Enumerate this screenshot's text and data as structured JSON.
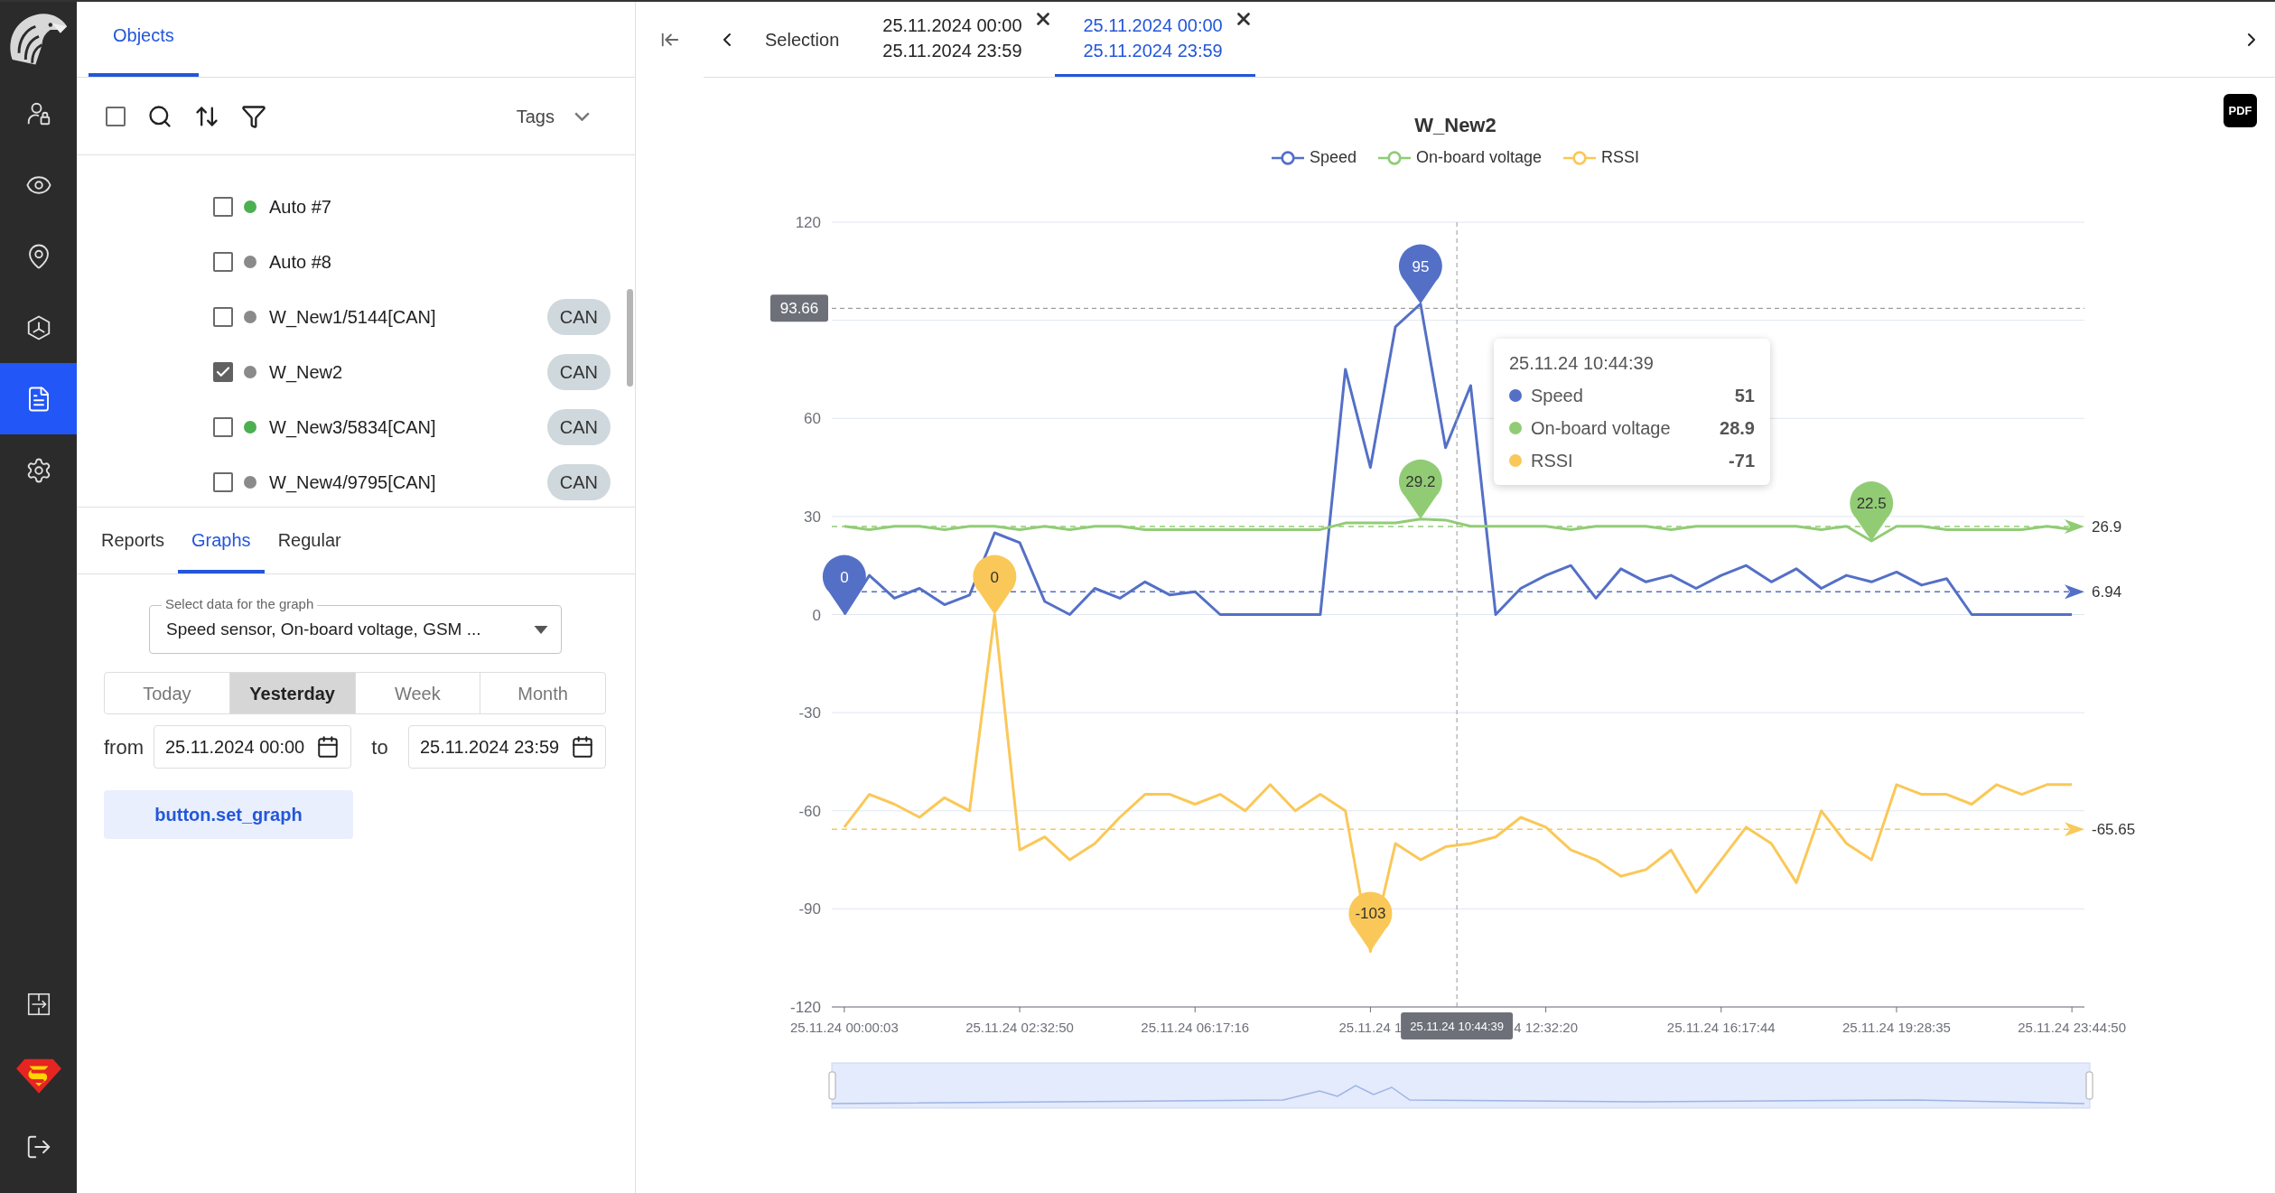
{
  "rail": {
    "items": [
      {
        "kind": "userlock",
        "selected": false
      },
      {
        "kind": "eye",
        "selected": false
      },
      {
        "kind": "pin",
        "selected": false
      },
      {
        "kind": "hexagon",
        "selected": false
      },
      {
        "kind": "file",
        "selected": true
      },
      {
        "kind": "settings",
        "selected": false
      }
    ],
    "bottom_items": [
      {
        "kind": "panels"
      },
      {
        "kind": "emblem"
      },
      {
        "kind": "logout"
      }
    ]
  },
  "objects_panel": {
    "tabs": [
      {
        "label": "Objects",
        "selected": true
      }
    ],
    "toolbar": {
      "select_all": {
        "checked": false
      },
      "tags_label": "Tags"
    },
    "items": [
      {
        "name": "Auto #7",
        "checked": false,
        "color": "#4caf50"
      },
      {
        "name": "Auto #8",
        "checked": false,
        "color": "#8a8a8a"
      },
      {
        "name": "W_New1/5144[CAN]",
        "checked": false,
        "color": "#8a8a8a",
        "tag": "CAN"
      },
      {
        "name": "W_New2",
        "checked": true,
        "color": "#8a8a8a",
        "tag": "CAN"
      },
      {
        "name": "W_New3/5834[CAN]",
        "checked": false,
        "color": "#4caf50",
        "tag": "CAN"
      },
      {
        "name": "W_New4/9795[CAN]",
        "checked": false,
        "color": "#8a8a8a",
        "tag": "CAN"
      }
    ]
  },
  "report_panel": {
    "tabs": [
      {
        "label": "Reports",
        "selected": false
      },
      {
        "label": "Graphs",
        "selected": true
      },
      {
        "label": "Regular",
        "selected": false
      }
    ],
    "data_select": {
      "label": "Select data for the graph",
      "value": "Speed sensor, On-board voltage, GSM ..."
    },
    "periods": [
      {
        "label": "Today",
        "selected": false
      },
      {
        "label": "Yesterday",
        "selected": true
      },
      {
        "label": "Week",
        "selected": false
      },
      {
        "label": "Month",
        "selected": false
      }
    ],
    "from_label": "from",
    "from_value": "25.11.2024 00:00",
    "to_label": "to",
    "to_value": "25.11.2024 23:59",
    "submit": "button.set_graph"
  },
  "header": {
    "selection_label": "Selection",
    "tabs": [
      {
        "line1": "25.11.2024 00:00",
        "line2": "25.11.2024 23:59",
        "selected": false
      },
      {
        "line1": "25.11.2024 00:00",
        "line2": "25.11.2024 23:59",
        "selected": true
      }
    ]
  },
  "graph": {
    "pdf_label": "PDF",
    "chart_data": {
      "type": "line",
      "title": "W_New2",
      "legend": "top",
      "grid": true,
      "categories": [
        "25.11.24 00:00:03",
        null,
        null,
        null,
        null,
        null,
        null,
        "25.11.24 02:32:50",
        null,
        null,
        null,
        null,
        null,
        null,
        "25.11.24 06:17:16",
        null,
        null,
        null,
        null,
        null,
        null,
        "25.11.24 1",
        null,
        null,
        null,
        null,
        null,
        null,
        "4 12:32:20",
        null,
        null,
        null,
        null,
        null,
        null,
        "25.11.24 16:17:44",
        null,
        null,
        null,
        null,
        null,
        null,
        "25.11.24 19:28:35",
        null,
        null,
        null,
        null,
        null,
        null,
        "25.11.24 23:44:50"
      ],
      "ylim": [
        -120,
        120
      ],
      "yticks": [
        -120,
        -90,
        -60,
        -30,
        0,
        30,
        60,
        120
      ],
      "series": [
        {
          "name": "Speed",
          "color": "#5470c6",
          "values": [
            0,
            12,
            5,
            8,
            3,
            6,
            25,
            22,
            4,
            0,
            8,
            5,
            10,
            6,
            7,
            0,
            0,
            0,
            0,
            0,
            75,
            45,
            88,
            95,
            51,
            70,
            0,
            8,
            12,
            15,
            5,
            14,
            10,
            12,
            8,
            12,
            15,
            10,
            14,
            8,
            12,
            10,
            13,
            9,
            11,
            0,
            0,
            0,
            0,
            0
          ]
        },
        {
          "name": "On-board voltage",
          "color": "#91cc75",
          "values": [
            27,
            26,
            27,
            27,
            26,
            27,
            27,
            26,
            27,
            26,
            27,
            27,
            26,
            26,
            26,
            26,
            26,
            26,
            26,
            26,
            28,
            28,
            28,
            29.2,
            28.9,
            27,
            27,
            27,
            27,
            26,
            27,
            27,
            27,
            26,
            27,
            27,
            27,
            27,
            27,
            26,
            27,
            22.5,
            27,
            27,
            26,
            26,
            26,
            26,
            27,
            26
          ]
        },
        {
          "name": "RSSI",
          "color": "#fac858",
          "values": [
            -65,
            -55,
            -58,
            -62,
            -56,
            -60,
            0,
            -72,
            -68,
            -75,
            -70,
            -62,
            -55,
            -55,
            -58,
            -55,
            -60,
            -52,
            -60,
            -55,
            -60,
            -103,
            -70,
            -75,
            -71,
            -70,
            -68,
            -62,
            -65,
            -72,
            -75,
            -80,
            -78,
            -72,
            -85,
            -75,
            -65,
            -70,
            -82,
            -60,
            -70,
            -75,
            -52,
            -55,
            -55,
            -58,
            -52,
            -55,
            -52,
            -52
          ]
        }
      ],
      "annotations": [
        {
          "y": 95,
          "text": "95"
        },
        {
          "y": 0,
          "text": "0"
        },
        {
          "y": 29.2,
          "text": "29.2"
        },
        {
          "y": 22.5,
          "text": "22.5"
        },
        {
          "y": 0,
          "text": "0"
        },
        {
          "y": -103,
          "text": "-103"
        },
        "25.11.24 10:44:39"
      ],
      "ref_lines": [
        {
          "axis": "y",
          "value": 26.9,
          "label": "26.9",
          "color": "#91cc75"
        },
        {
          "axis": "y",
          "value": 6.94,
          "label": "6.94",
          "color": "#5470c6"
        },
        {
          "axis": "y",
          "value": -65.65,
          "label": "-65.65",
          "color": "#fac858"
        },
        {
          "axis": "y",
          "value": 93.66,
          "label": "93.66"
        }
      ]
    },
    "tooltip": {
      "title": "25.11.24 10:44:39",
      "rows": [
        {
          "name": "Speed",
          "value": "51",
          "color": "#5470c6"
        },
        {
          "name": "On-board voltage",
          "value": "28.9",
          "color": "#91cc75"
        },
        {
          "name": "RSSI",
          "value": "-71",
          "color": "#fac858"
        }
      ]
    }
  }
}
